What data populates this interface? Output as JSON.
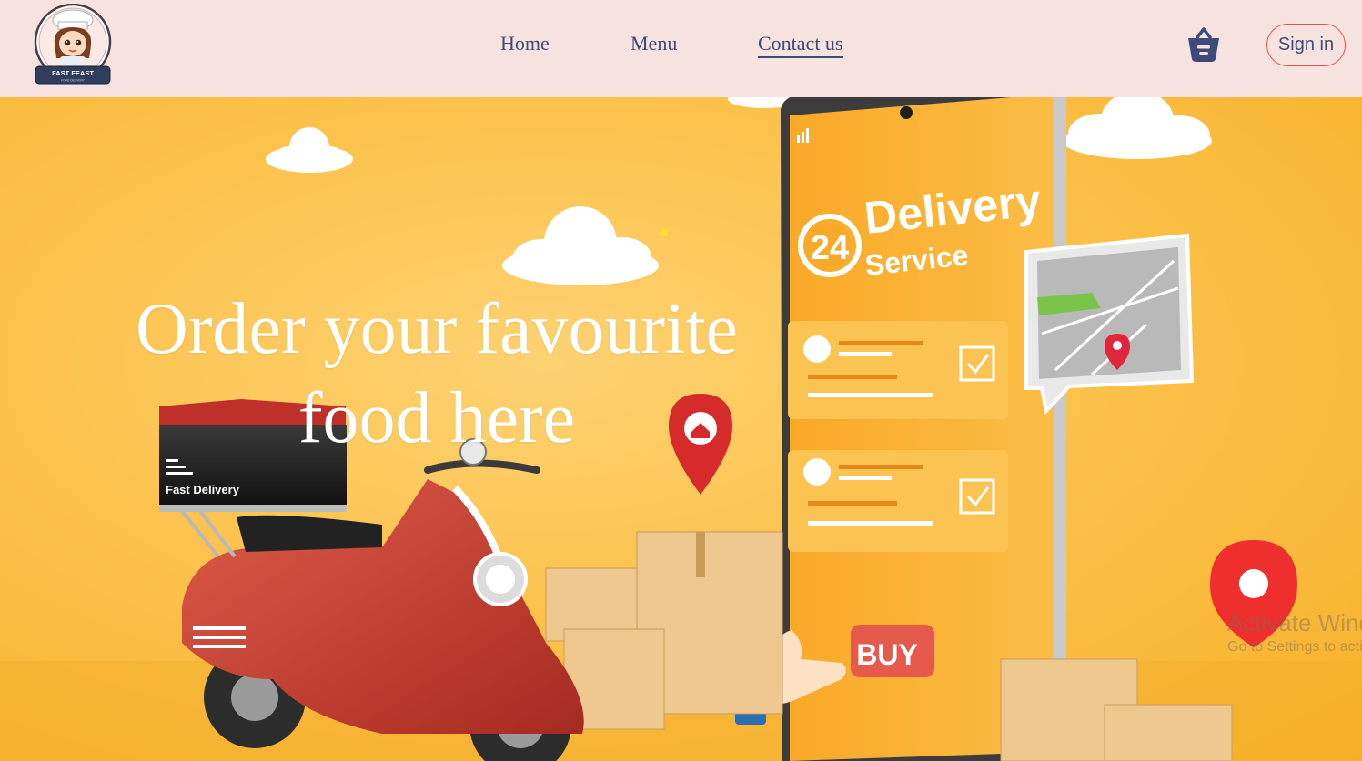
{
  "header": {
    "logo": {
      "brand": "FAST FEAST",
      "tagline": "FOOD DELIVERY"
    },
    "nav": [
      {
        "label": "Home",
        "active": false
      },
      {
        "label": "Menu",
        "active": false
      },
      {
        "label": "Contact us",
        "active": true
      }
    ],
    "cart_icon": "basket-icon",
    "signin_label": "Sign in"
  },
  "hero": {
    "headline": "Order your favourite food here",
    "illustration": {
      "phone_badge_number": "24",
      "phone_title": "Delivery",
      "phone_subtitle": "Service",
      "box_label": "Fast Delivery",
      "buy_button": "BUY"
    }
  },
  "watermark": {
    "title": "Activate Windows",
    "subtitle": "Go to Settings to activate Windows."
  },
  "colors": {
    "header_bg": "#f6e3df",
    "nav_text": "#3e4b78",
    "signin_border": "#e0584b",
    "hero_bg": "#fcc24c"
  }
}
